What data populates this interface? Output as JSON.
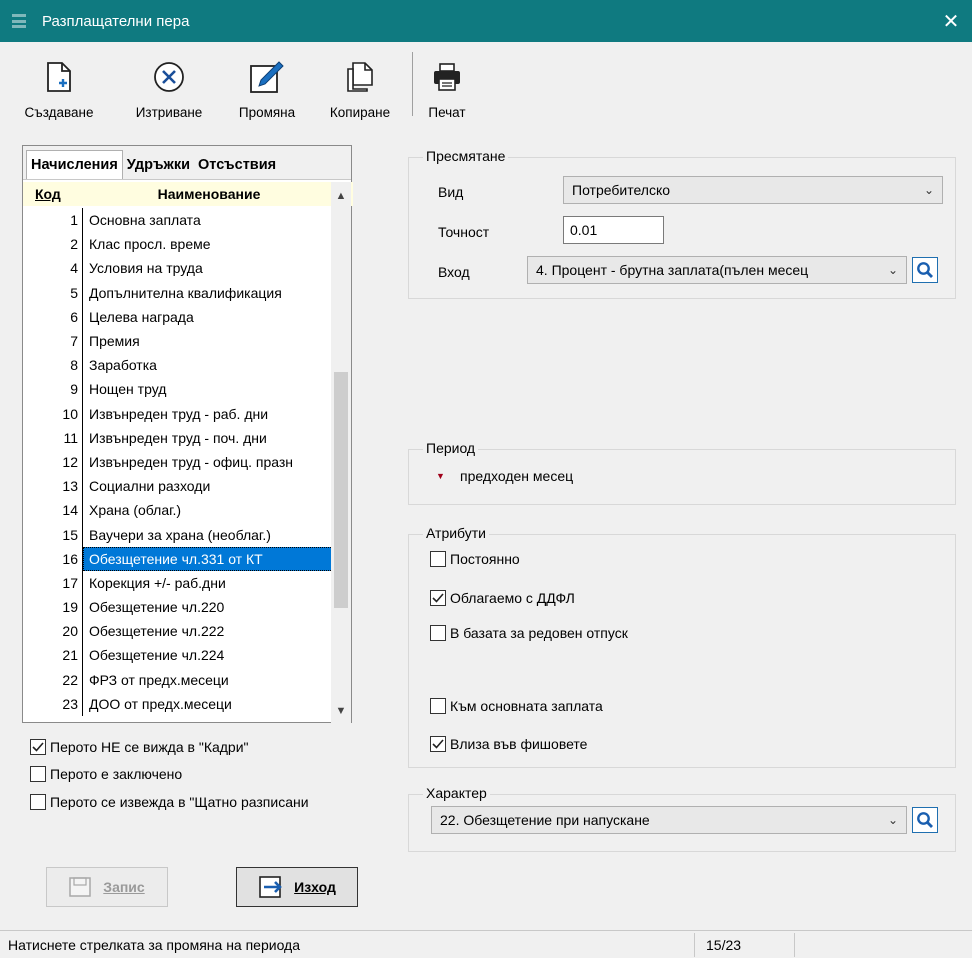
{
  "window": {
    "title": "Разплащателни пера",
    "close_glyph": "✕"
  },
  "toolbar": {
    "create_label": "Създаване",
    "delete_label": "Изтриване",
    "edit_label": "Промяна",
    "copy_label": "Копиране",
    "print_label": "Печат"
  },
  "tabs": [
    "Начисления",
    "Удръжки",
    "Отсъствия"
  ],
  "list": {
    "col_code": "Код",
    "col_name": "Наименование",
    "rows": [
      {
        "code": "1",
        "name": "Основна заплата"
      },
      {
        "code": "2",
        "name": "Клас просл. време"
      },
      {
        "code": "4",
        "name": "Условия на труда"
      },
      {
        "code": "5",
        "name": "Допълнителна квалификация"
      },
      {
        "code": "6",
        "name": "Целева награда"
      },
      {
        "code": "7",
        "name": "Премия"
      },
      {
        "code": "8",
        "name": "Заработка"
      },
      {
        "code": "9",
        "name": "Нощен труд"
      },
      {
        "code": "10",
        "name": "Извънреден труд - раб. дни"
      },
      {
        "code": "11",
        "name": "Извънреден труд - поч. дни"
      },
      {
        "code": "12",
        "name": "Извънреден труд - офиц. празн"
      },
      {
        "code": "13",
        "name": "Социални разходи"
      },
      {
        "code": "14",
        "name": "Храна (облаг.)"
      },
      {
        "code": "15",
        "name": "Ваучери за храна (необлаг.)"
      },
      {
        "code": "16",
        "name": "Обезщетение чл.331 от КТ"
      },
      {
        "code": "17",
        "name": "Корекция +/- раб.дни"
      },
      {
        "code": "19",
        "name": "Обезщетение чл.220"
      },
      {
        "code": "20",
        "name": "Обезщетение чл.222"
      },
      {
        "code": "21",
        "name": "Обезщетение чл.224"
      },
      {
        "code": "22",
        "name": "ФРЗ от предх.месеци"
      },
      {
        "code": "23",
        "name": "ДОО от предх.месеци"
      }
    ],
    "selected_code": "16"
  },
  "left_checks": {
    "hidden_in_kadri": {
      "label": "Перото НЕ се вижда в \"Кадри\"",
      "checked": true
    },
    "locked": {
      "label": "Перото е заключено",
      "checked": false
    },
    "in_staff_schedule": {
      "label": "Перото се извежда в \"Щатно разписани",
      "checked": false
    }
  },
  "buttons": {
    "save_label": "Запис",
    "exit_label": "Изход"
  },
  "calc": {
    "group_title": "Пресмятане",
    "type_label": "Вид",
    "type_value": "Потребителско",
    "precision_label": "Точност",
    "precision_value": "0.01",
    "input_label": "Вход",
    "input_value": "4. Процент - брутна заплата(пълен месец"
  },
  "period": {
    "group_title": "Период",
    "value": "предходен месец"
  },
  "attributes": {
    "group_title": "Атрибути",
    "permanent": {
      "label": "Постоянно",
      "checked": false
    },
    "taxable": {
      "label": "Облагаемо с ДДФЛ",
      "checked": true
    },
    "vacation_base": {
      "label": "В базата за редовен отпуск",
      "checked": false
    },
    "to_base_salary": {
      "label": "Към основната заплата",
      "checked": false
    },
    "in_payslips": {
      "label": "Влиза във фишовете",
      "checked": true
    }
  },
  "character": {
    "group_title": "Характер",
    "value": "22. Обезщетение при напускане"
  },
  "status": {
    "message": "Натиснете стрелката за промяна на периода",
    "counter": "15/23"
  },
  "colors": {
    "titlebar": "#0f7a80",
    "selection": "#0078d7",
    "header_bg": "#fffde0",
    "period_arrow": "#a0001a"
  }
}
